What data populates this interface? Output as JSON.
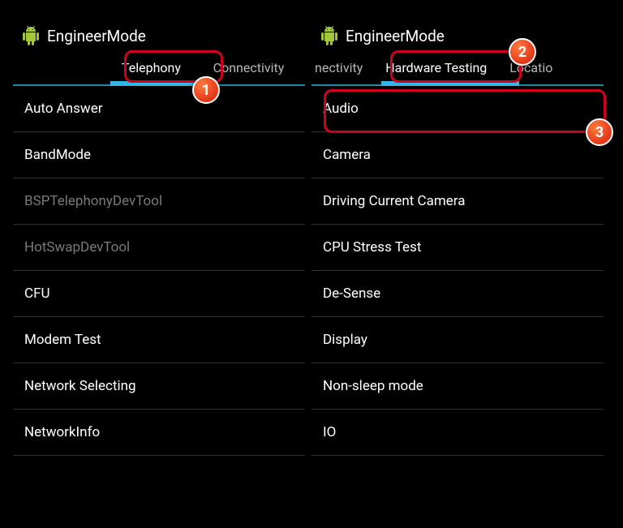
{
  "app_title": "EngineerMode",
  "left": {
    "tabs": {
      "active": "Telephony",
      "other": "Connectivity"
    },
    "items": [
      {
        "label": "Auto Answer",
        "dim": false
      },
      {
        "label": "BandMode",
        "dim": false
      },
      {
        "label": "BSPTelephonyDevTool",
        "dim": true
      },
      {
        "label": "HotSwapDevTool",
        "dim": true
      },
      {
        "label": "CFU",
        "dim": false
      },
      {
        "label": "Modem Test",
        "dim": false
      },
      {
        "label": "Network Selecting",
        "dim": false
      },
      {
        "label": "NetworkInfo",
        "dim": false
      }
    ]
  },
  "right": {
    "tabs": {
      "prev": "nectivity",
      "active": "Hardware Testing",
      "next": "Locatio"
    },
    "items": [
      {
        "label": "Audio"
      },
      {
        "label": "Camera"
      },
      {
        "label": "Driving Current Camera"
      },
      {
        "label": "CPU Stress Test"
      },
      {
        "label": "De-Sense"
      },
      {
        "label": "Display"
      },
      {
        "label": "Non-sleep mode"
      },
      {
        "label": "IO"
      }
    ]
  },
  "annotations": {
    "b1": "1",
    "b2": "2",
    "b3": "3"
  },
  "colors": {
    "accent": "#33b5e5",
    "divider": "#303030",
    "highlight": "#d1001f",
    "badge": "#e2371a"
  }
}
